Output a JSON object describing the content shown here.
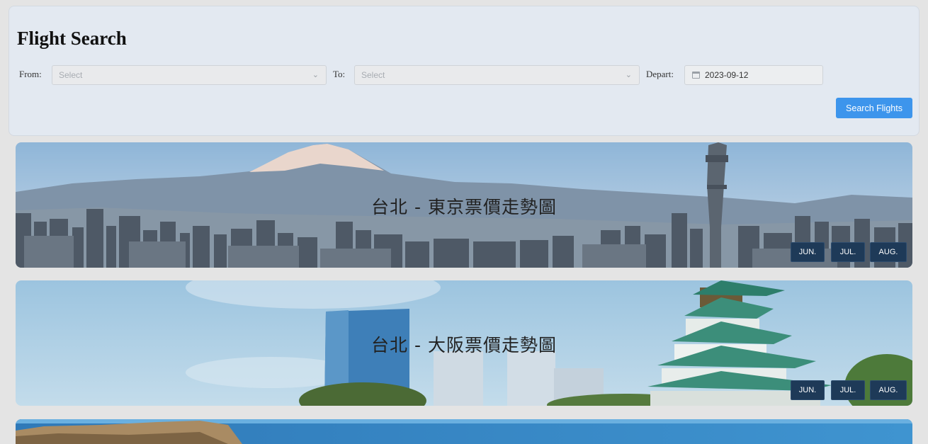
{
  "search": {
    "title": "Flight Search",
    "from_label": "From:",
    "from_placeholder": "Select",
    "to_label": "To:",
    "to_placeholder": "Select",
    "depart_label": "Depart:",
    "depart_value": "2023-09-12",
    "button_label": "Search Flights"
  },
  "routes": [
    {
      "title": "台北 - 東京票價走勢圖",
      "months": [
        "JUN.",
        "JUL.",
        "AUG."
      ]
    },
    {
      "title": "台北 - 大阪票價走勢圖",
      "months": [
        "JUN.",
        "JUL.",
        "AUG."
      ]
    }
  ],
  "colors": {
    "accent": "#3d95ec",
    "month_button": "#1e3a58",
    "panel": "#e3e9f1"
  }
}
